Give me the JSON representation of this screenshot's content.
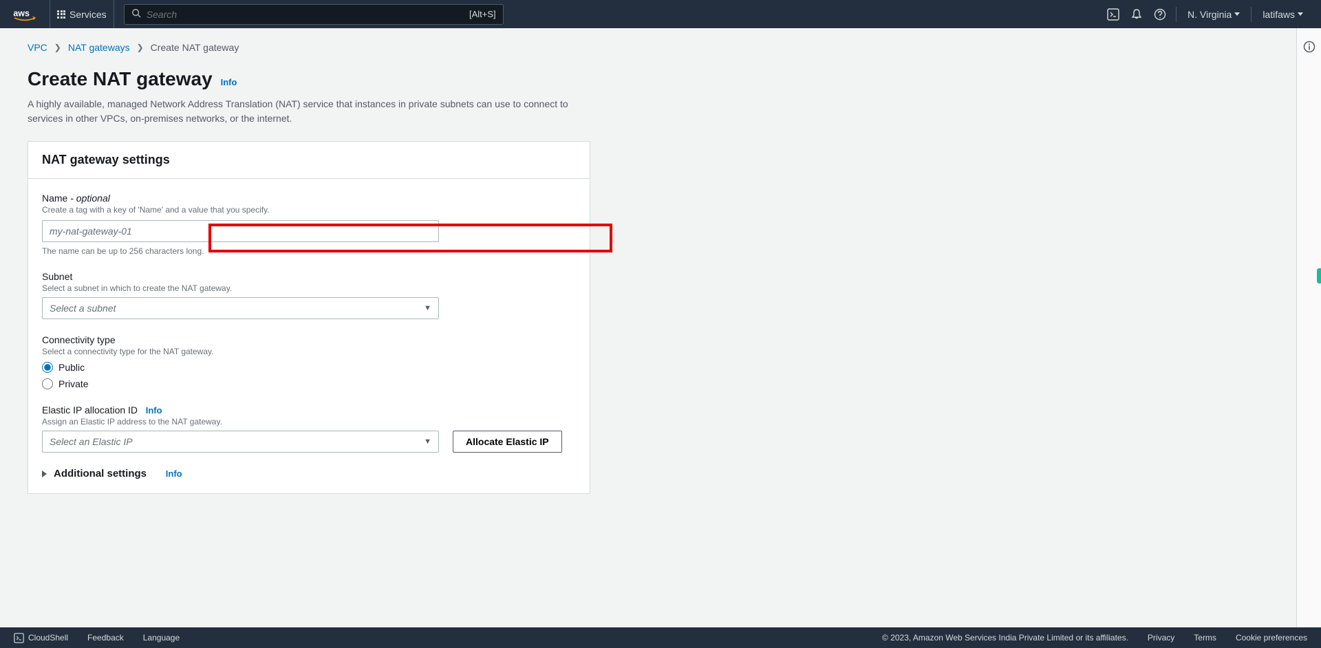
{
  "nav": {
    "services_label": "Services",
    "search_placeholder": "Search",
    "search_shortcut": "[Alt+S]",
    "region": "N. Virginia",
    "user": "latifaws"
  },
  "breadcrumbs": {
    "items": [
      "VPC",
      "NAT gateways",
      "Create NAT gateway"
    ]
  },
  "page": {
    "title": "Create NAT gateway",
    "info": "Info",
    "description": "A highly available, managed Network Address Translation (NAT) service that instances in private subnets can use to connect to services in other VPCs, on-premises networks, or the internet."
  },
  "panel": {
    "heading": "NAT gateway settings",
    "name": {
      "label": "Name",
      "optional": " - optional",
      "desc": "Create a tag with a key of 'Name' and a value that you specify.",
      "placeholder": "my-nat-gateway-01",
      "hint": "The name can be up to 256 characters long."
    },
    "subnet": {
      "label": "Subnet",
      "desc": "Select a subnet in which to create the NAT gateway.",
      "placeholder": "Select a subnet"
    },
    "connectivity": {
      "label": "Connectivity type",
      "desc": "Select a connectivity type for the NAT gateway.",
      "option_public": "Public",
      "option_private": "Private"
    },
    "eip": {
      "label": "Elastic IP allocation ID",
      "info": "Info",
      "desc": "Assign an Elastic IP address to the NAT gateway.",
      "placeholder": "Select an Elastic IP",
      "allocate_btn": "Allocate Elastic IP"
    },
    "additional": {
      "label": "Additional settings",
      "info": "Info"
    }
  },
  "footer": {
    "cloudshell": "CloudShell",
    "feedback": "Feedback",
    "language": "Language",
    "copyright": "© 2023, Amazon Web Services India Private Limited or its affiliates.",
    "privacy": "Privacy",
    "terms": "Terms",
    "cookies": "Cookie preferences"
  }
}
